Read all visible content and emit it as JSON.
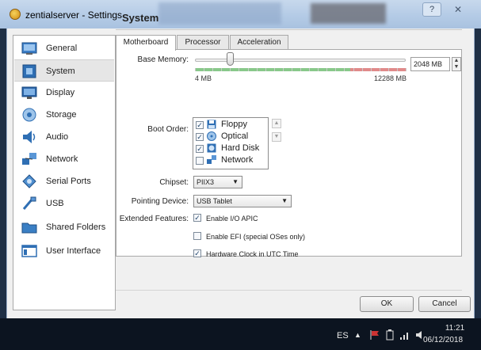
{
  "window": {
    "title": "zentialserver - Settings",
    "help_label": "?",
    "close_label": "✕"
  },
  "sidebar": {
    "items": [
      {
        "label": "General",
        "icon": "general-icon"
      },
      {
        "label": "System",
        "icon": "system-icon",
        "selected": true
      },
      {
        "label": "Display",
        "icon": "display-icon"
      },
      {
        "label": "Storage",
        "icon": "storage-icon"
      },
      {
        "label": "Audio",
        "icon": "audio-icon"
      },
      {
        "label": "Network",
        "icon": "network-icon"
      },
      {
        "label": "Serial Ports",
        "icon": "serial-ports-icon"
      },
      {
        "label": "USB",
        "icon": "usb-icon"
      },
      {
        "label": "Shared Folders",
        "icon": "shared-folders-icon"
      },
      {
        "label": "User Interface",
        "icon": "user-interface-icon"
      }
    ]
  },
  "panel": {
    "title": "System"
  },
  "tabs": [
    {
      "label": "Motherboard",
      "active": true
    },
    {
      "label": "Processor"
    },
    {
      "label": "Acceleration"
    }
  ],
  "motherboard": {
    "base_memory_label": "Base Memory:",
    "memory_min": "4 MB",
    "memory_max": "12288 MB",
    "memory_value": "2048 MB",
    "memory_fraction": 0.167,
    "boot_order_label": "Boot Order:",
    "boot_items": [
      {
        "label": "Floppy",
        "checked": true,
        "icon": "floppy-icon"
      },
      {
        "label": "Optical",
        "checked": true,
        "icon": "optical-disc-icon"
      },
      {
        "label": "Hard Disk",
        "checked": true,
        "icon": "hard-disk-icon"
      },
      {
        "label": "Network",
        "checked": false,
        "icon": "network-boot-icon"
      }
    ],
    "chipset_label": "Chipset:",
    "chipset_value": "PIIX3",
    "pointing_label": "Pointing Device:",
    "pointing_value": "USB Tablet",
    "ext_label": "Extended Features:",
    "features": [
      {
        "label": "Enable I/O APIC",
        "checked": true
      },
      {
        "label": "Enable EFI (special OSes only)",
        "checked": false
      },
      {
        "label": "Hardware Clock in UTC Time",
        "checked": true
      }
    ]
  },
  "buttons": {
    "ok": "OK",
    "cancel": "Cancel"
  },
  "taskbar": {
    "lang": "ES",
    "time": "11:21",
    "date": "06/12/2018"
  },
  "colors": {
    "accent": "#3a78c2",
    "mem_green": "#88c88a",
    "mem_red": "#e08a8a"
  }
}
